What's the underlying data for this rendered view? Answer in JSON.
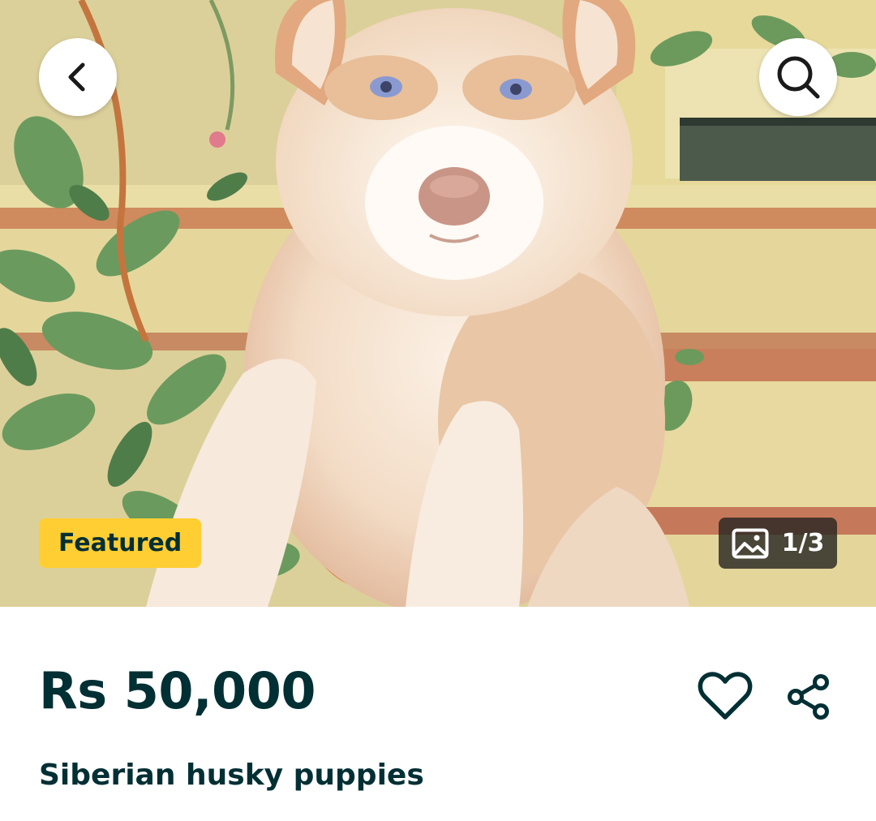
{
  "hero": {
    "photo_description": "husky-puppy-photo",
    "back_icon": "chevron-left-icon",
    "search_icon": "search-icon",
    "badge_label": "Featured",
    "gallery_icon": "image-icon",
    "gallery_counter": "1/3"
  },
  "listing": {
    "price": "Rs 50,000",
    "title": "Siberian husky puppies",
    "favorite_icon": "heart-icon",
    "share_icon": "share-icon"
  },
  "colors": {
    "text_primary": "#002f34",
    "badge_background": "#ffce32",
    "counter_background": "#282622"
  }
}
